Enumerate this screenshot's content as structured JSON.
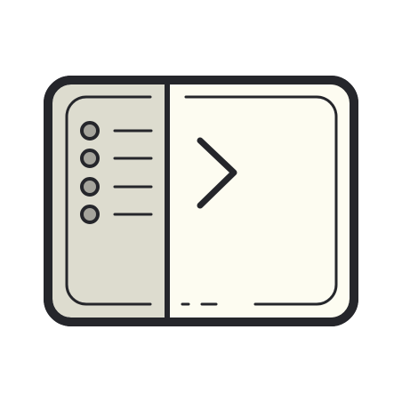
{
  "icon": {
    "name": "terminal-sidebar-window-icon",
    "colors": {
      "background": "#ffffff",
      "frame_stroke": "#25262b",
      "outer_fill": "#e8e7de",
      "sidebar_fill": "#dddccf",
      "content_fill": "#fdfcf1",
      "bullet_fill": "#a5a49c"
    }
  },
  "sidebar": {
    "items": [
      {
        "name": "list-item-1"
      },
      {
        "name": "list-item-2"
      },
      {
        "name": "list-item-3"
      },
      {
        "name": "list-item-4"
      }
    ]
  },
  "content": {
    "prompt_icon": "chevron-right-icon"
  }
}
